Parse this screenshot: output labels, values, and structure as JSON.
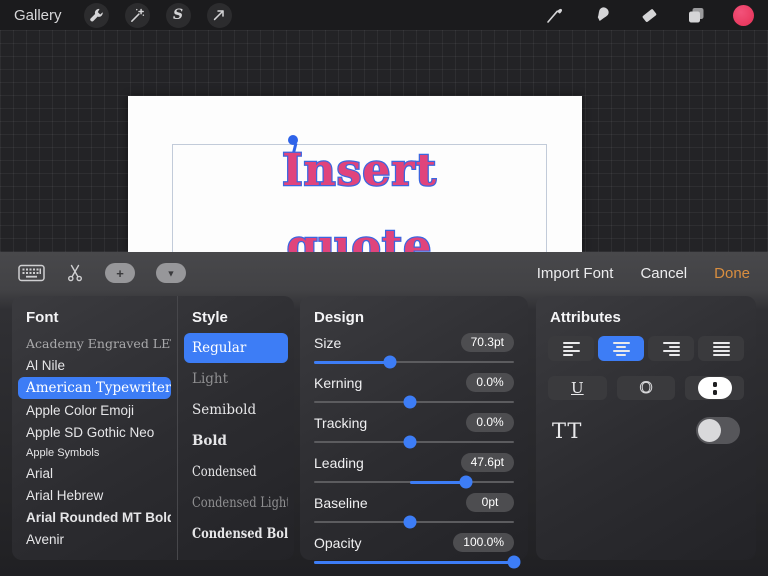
{
  "topbar": {
    "gallery_label": "Gallery"
  },
  "canvas": {
    "text_line1": "Insert",
    "text_line2": "quote"
  },
  "toolbar": {
    "import_font_label": "Import Font",
    "cancel_label": "Cancel",
    "done_label": "Done"
  },
  "font_panel": {
    "header": "Font",
    "items": [
      {
        "label": "Academy Engraved LET",
        "cls": "engraved",
        "selected": false
      },
      {
        "label": "Al Nile",
        "cls": "sans",
        "selected": false
      },
      {
        "label": "American Typewriter",
        "cls": "typewriter",
        "selected": true
      },
      {
        "label": "Apple Color Emoji",
        "cls": "sans",
        "selected": false
      },
      {
        "label": "Apple SD Gothic Neo",
        "cls": "sans",
        "selected": false
      },
      {
        "label": "Apple Symbols",
        "cls": "symbols",
        "selected": false
      },
      {
        "label": "Arial",
        "cls": "sans",
        "selected": false
      },
      {
        "label": "Arial Hebrew",
        "cls": "sans",
        "selected": false
      },
      {
        "label": "Arial Rounded MT Bold",
        "cls": "sans-bold",
        "selected": false
      },
      {
        "label": "Avenir",
        "cls": "sans",
        "selected": false
      }
    ]
  },
  "style_panel": {
    "header": "Style",
    "items": [
      {
        "label": "Regular",
        "cls": "tw",
        "selected": true
      },
      {
        "label": "Light",
        "cls": "tw-light",
        "selected": false
      },
      {
        "label": "Semibold",
        "cls": "tw-semibold",
        "selected": false
      },
      {
        "label": "Bold",
        "cls": "tw-bold",
        "selected": false
      },
      {
        "label": "Condensed",
        "cls": "tw-cond",
        "selected": false
      },
      {
        "label": "Condensed Light",
        "cls": "tw-cond-light",
        "selected": false
      },
      {
        "label": "Condensed Bold",
        "cls": "tw-cond-bold",
        "selected": false
      }
    ]
  },
  "design_panel": {
    "header": "Design",
    "center_pct": 48,
    "sliders": [
      {
        "label": "Size",
        "value": "70.3pt",
        "pct": 38,
        "fill": "left"
      },
      {
        "label": "Kerning",
        "value": "0.0%",
        "pct": 48,
        "fill": "center"
      },
      {
        "label": "Tracking",
        "value": "0.0%",
        "pct": 48,
        "fill": "center"
      },
      {
        "label": "Leading",
        "value": "47.6pt",
        "pct": 76,
        "fill": "center"
      },
      {
        "label": "Baseline",
        "value": "0pt",
        "pct": 48,
        "fill": "center"
      },
      {
        "label": "Opacity",
        "value": "100.0%",
        "pct": 100,
        "fill": "left"
      }
    ]
  },
  "attributes_panel": {
    "header": "Attributes",
    "alignment": [
      "left",
      "center",
      "right",
      "justify"
    ],
    "selected_alignment": "center",
    "underline_label": "U",
    "outline_label": "O",
    "tt_label": "TT",
    "toggle_on": false
  },
  "icons": {
    "topbar_left": [
      "actions-wrench-icon",
      "adjustments-wand-icon",
      "selection-icon",
      "transform-arrow-icon"
    ],
    "topbar_right": [
      "brush-icon",
      "smudge-icon",
      "eraser-icon",
      "layers-icon",
      "color-swatch"
    ],
    "sheet_toolbar": [
      "keyboard-icon",
      "scissors-icon",
      "plus-pill-button",
      "chevron-down-pill-button"
    ]
  },
  "colors": {
    "accent_blue": "#3D7DF6",
    "done_orange": "#D98E3F",
    "canvas_text_pink": "#E0447C",
    "canvas_text_outline_blue": "#3B66E0",
    "color_swatch_pink": "#ED3E64"
  }
}
